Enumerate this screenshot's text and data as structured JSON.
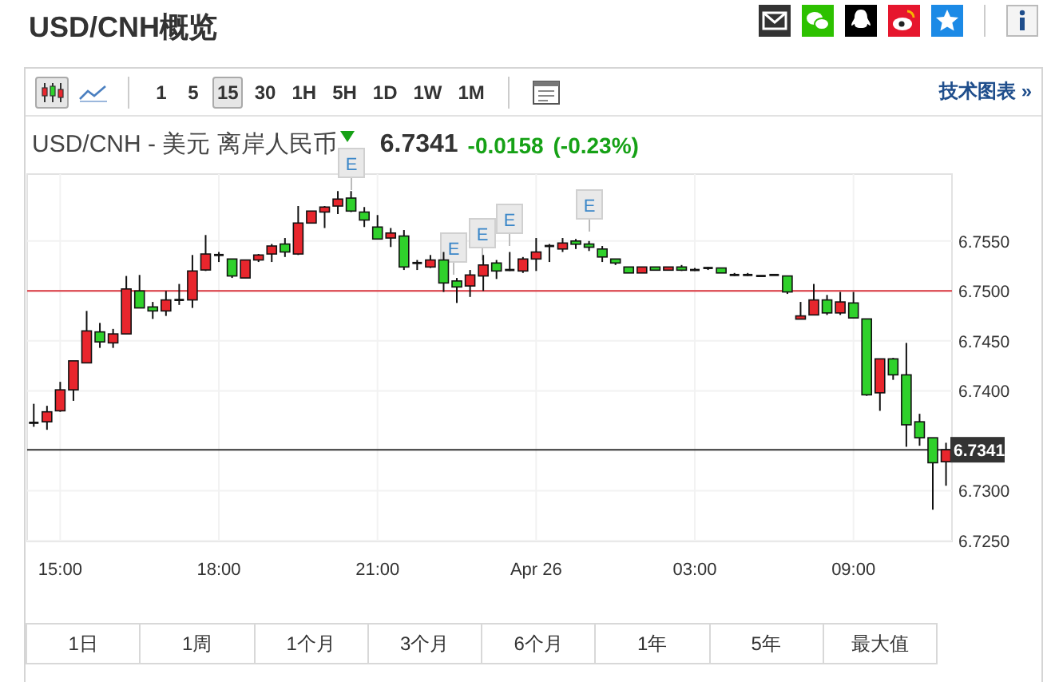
{
  "header": {
    "title": "USD/CNH概览"
  },
  "toolbar": {
    "chart_types": [
      {
        "kind": "candle",
        "selected": true
      },
      {
        "kind": "line",
        "selected": false
      }
    ],
    "intervals": [
      {
        "label": "1",
        "selected": false
      },
      {
        "label": "5",
        "selected": false
      },
      {
        "label": "15",
        "selected": true
      },
      {
        "label": "30",
        "selected": false
      },
      {
        "label": "1H",
        "selected": false
      },
      {
        "label": "5H",
        "selected": false
      },
      {
        "label": "1D",
        "selected": false
      },
      {
        "label": "1W",
        "selected": false
      },
      {
        "label": "1M",
        "selected": false
      }
    ],
    "link": "技术图表 »"
  },
  "quote": {
    "name": "USD/CNH - 美元 离岸人民币",
    "price": "6.7341",
    "change": "-0.0158",
    "change_percent": "(-0.23%)"
  },
  "chart": {
    "current_price": "6.7341",
    "events": [
      {
        "label": "E"
      },
      {
        "label": "E"
      },
      {
        "label": "E"
      },
      {
        "label": "E"
      },
      {
        "label": "E"
      }
    ],
    "chart_data": {
      "type": "candlestick",
      "categories": [
        null,
        null,
        "15:00",
        null,
        null,
        null,
        null,
        null,
        null,
        null,
        null,
        null,
        null,
        null,
        "18:00",
        null,
        null,
        null,
        null,
        null,
        null,
        null,
        null,
        null,
        null,
        null,
        "21:00",
        null,
        null,
        null,
        null,
        null,
        null,
        null,
        null,
        null,
        null,
        null,
        "Apr 26",
        null,
        null,
        null,
        null,
        null,
        null,
        null,
        null,
        null,
        null,
        null,
        "03:00",
        null,
        null,
        null,
        null,
        null,
        null,
        null,
        null,
        null,
        null,
        null,
        "09:00",
        null,
        null,
        null,
        null,
        null,
        null,
        null
      ],
      "ohlc": [
        [
          6.7368,
          6.7387,
          6.7364,
          6.7368
        ],
        [
          6.7369,
          6.7385,
          6.7361,
          6.7379
        ],
        [
          6.738,
          6.7409,
          6.7379,
          6.7401
        ],
        [
          6.7401,
          6.743,
          6.739,
          6.743
        ],
        [
          6.7428,
          6.748,
          6.7428,
          6.746
        ],
        [
          6.7459,
          6.7468,
          6.7443,
          6.7449
        ],
        [
          6.7448,
          6.7462,
          6.7443,
          6.7457
        ],
        [
          6.7457,
          6.7515,
          6.7457,
          6.7502
        ],
        [
          6.75,
          6.7516,
          6.7483,
          6.7483
        ],
        [
          6.7484,
          6.7489,
          6.7472,
          6.748
        ],
        [
          6.748,
          6.75,
          6.7475,
          6.7491
        ],
        [
          6.7491,
          6.7507,
          6.7486,
          6.7491
        ],
        [
          6.7491,
          6.7536,
          6.7483,
          6.752
        ],
        [
          6.7521,
          6.7556,
          6.752,
          6.7537
        ],
        [
          6.7536,
          6.7539,
          6.7529,
          6.7536
        ],
        [
          6.7532,
          6.7532,
          6.7513,
          6.7515
        ],
        [
          6.7513,
          6.7531,
          6.7513,
          6.7531
        ],
        [
          6.7531,
          6.7537,
          6.7529,
          6.7536
        ],
        [
          6.7537,
          6.7547,
          6.7529,
          6.7545
        ],
        [
          6.7547,
          6.7553,
          6.7534,
          6.7539
        ],
        [
          6.7537,
          6.7585,
          6.7536,
          6.7568
        ],
        [
          6.7568,
          6.758,
          6.7568,
          6.758
        ],
        [
          6.7579,
          6.7585,
          6.7563,
          6.7584
        ],
        [
          6.7585,
          6.76,
          6.7577,
          6.7592
        ],
        [
          6.7593,
          6.76,
          6.7579,
          6.758
        ],
        [
          6.7579,
          6.7584,
          6.7564,
          6.7571
        ],
        [
          6.7564,
          6.7576,
          6.7552,
          6.7552
        ],
        [
          6.7553,
          6.7563,
          6.7544,
          6.7558
        ],
        [
          6.7555,
          6.7561,
          6.7521,
          6.7524
        ],
        [
          6.7528,
          6.7531,
          6.7521,
          6.7528
        ],
        [
          6.7524,
          6.7536,
          6.7523,
          6.7531
        ],
        [
          6.7531,
          6.7539,
          6.7499,
          6.7508
        ],
        [
          6.751,
          6.7513,
          6.7488,
          6.7504
        ],
        [
          6.7505,
          6.7521,
          6.7494,
          6.7516
        ],
        [
          6.7515,
          6.7536,
          6.75,
          6.7526
        ],
        [
          6.7528,
          6.7531,
          6.7512,
          6.752
        ],
        [
          6.7521,
          6.7539,
          6.752,
          6.7521
        ],
        [
          6.752,
          6.7534,
          6.7518,
          6.7532
        ],
        [
          6.7532,
          6.7553,
          6.752,
          6.7539
        ],
        [
          6.7545,
          6.7547,
          6.7529,
          6.7545
        ],
        [
          6.7542,
          6.7553,
          6.7539,
          6.7548
        ],
        [
          6.755,
          6.7552,
          6.7542,
          6.7547
        ],
        [
          6.7547,
          6.755,
          6.754,
          6.7544
        ],
        [
          6.7542,
          6.7545,
          6.7529,
          6.7534
        ],
        [
          6.7532,
          6.7532,
          6.7526,
          6.7528
        ],
        [
          6.7524,
          6.7524,
          6.7518,
          6.7518
        ],
        [
          6.7518,
          6.7524,
          6.7518,
          6.7524
        ],
        [
          6.7524,
          6.7524,
          6.7521,
          6.7521
        ],
        [
          6.7521,
          6.7524,
          6.7521,
          6.7524
        ],
        [
          6.7524,
          6.7526,
          6.752,
          6.7521
        ],
        [
          6.7521,
          6.7523,
          6.752,
          6.7521
        ],
        [
          6.7523,
          6.7524,
          6.7521,
          6.7523
        ],
        [
          6.7523,
          6.7523,
          6.7518,
          6.7518
        ],
        [
          6.7516,
          6.7518,
          6.7515,
          6.7516
        ],
        [
          6.7516,
          6.7518,
          6.7515,
          6.7516
        ],
        [
          6.7515,
          6.7515,
          6.7515,
          6.7515
        ],
        [
          6.7516,
          6.7516,
          6.7516,
          6.7516
        ],
        [
          6.7515,
          6.7515,
          6.7497,
          6.7499
        ],
        [
          6.7472,
          6.7489,
          6.7472,
          6.7475
        ],
        [
          6.7476,
          6.7507,
          6.7476,
          6.7491
        ],
        [
          6.7491,
          6.7496,
          6.7476,
          6.7478
        ],
        [
          6.7478,
          6.7499,
          6.7476,
          6.7489
        ],
        [
          6.7488,
          6.7499,
          6.7473,
          6.7473
        ],
        [
          6.7472,
          6.7472,
          6.7395,
          6.7396
        ],
        [
          6.7398,
          6.7432,
          6.738,
          6.7432
        ],
        [
          6.7432,
          6.7433,
          6.7411,
          6.7416
        ],
        [
          6.7416,
          6.7448,
          6.7344,
          6.7366
        ],
        [
          6.7369,
          6.7377,
          6.7345,
          6.7353
        ],
        [
          6.7353,
          6.7353,
          6.7281,
          6.7328
        ],
        [
          6.7329,
          6.7348,
          6.7305,
          6.7341
        ]
      ],
      "ylim": [
        6.725,
        6.7617
      ],
      "yticks": [
        {
          "value": 6.755,
          "label": "6.7550"
        },
        {
          "value": 6.75,
          "label": "6.7500"
        },
        {
          "value": 6.745,
          "label": "6.7450"
        },
        {
          "value": 6.74,
          "label": "6.7400"
        },
        {
          "value": 6.73,
          "label": "6.7300"
        },
        {
          "value": 6.725,
          "label": "6.7250"
        }
      ],
      "grid": true,
      "ref_lines": [
        {
          "axis": "y",
          "value": 6.75,
          "color": "#d9363e"
        },
        {
          "axis": "y",
          "value": 6.7341,
          "color": "#333333"
        }
      ]
    }
  },
  "ranges": [
    "1日",
    "1周",
    "1个月",
    "3个月",
    "6个月",
    "1年",
    "5年",
    "最大值"
  ]
}
